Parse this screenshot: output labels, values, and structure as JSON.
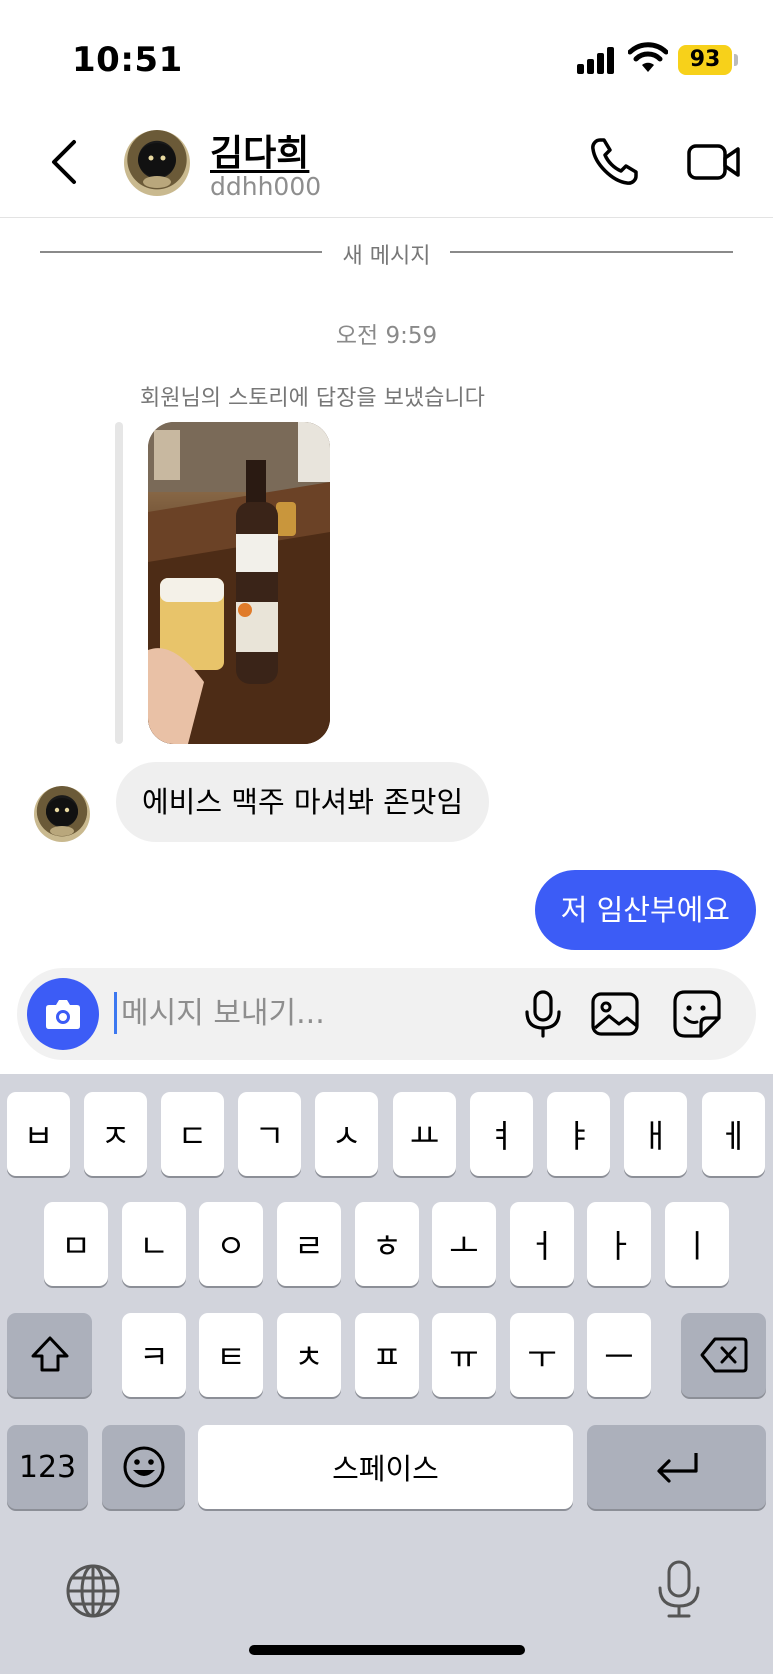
{
  "status_bar": {
    "time": "10:51",
    "battery": "93",
    "battery_color": "#f7d11a"
  },
  "header": {
    "name": "김다희",
    "username": "ddhh000",
    "back_icon": "chevron-left-icon",
    "call_icon": "phone-icon",
    "video_icon": "video-camera-icon"
  },
  "conversation": {
    "new_messages_label": "새 메시지",
    "timestamp": "오전 9:59",
    "story_reply_caption": "회원님의 스토리에 답장을 보냈습니다",
    "incoming_message": "에비스 맥주 마셔봐 존맛임",
    "outgoing_message": "저 임산부에요",
    "outgoing_color": "#3c5cf6"
  },
  "composer": {
    "placeholder": "메시지 보내기...",
    "value": "",
    "camera_icon": "camera-icon",
    "mic_icon": "microphone-icon",
    "gallery_icon": "image-icon",
    "sticker_icon": "sticker-icon"
  },
  "keyboard": {
    "row1": [
      "ㅂ",
      "ㅈ",
      "ㄷ",
      "ㄱ",
      "ㅅ",
      "ㅛ",
      "ㅕ",
      "ㅑ",
      "ㅐ",
      "ㅔ"
    ],
    "row2": [
      "ㅁ",
      "ㄴ",
      "ㅇ",
      "ㄹ",
      "ㅎ",
      "ㅗ",
      "ㅓ",
      "ㅏ",
      "ㅣ"
    ],
    "row3": [
      "ㅋ",
      "ㅌ",
      "ㅊ",
      "ㅍ",
      "ㅠ",
      "ㅜ",
      "ㅡ"
    ],
    "numbers_label": "123",
    "space_label": "스페이스",
    "shift_icon": "shift-icon",
    "delete_icon": "backspace-icon",
    "emoji_icon": "emoji-icon",
    "return_icon": "return-icon",
    "globe_icon": "globe-icon",
    "dictation_icon": "microphone-icon"
  }
}
